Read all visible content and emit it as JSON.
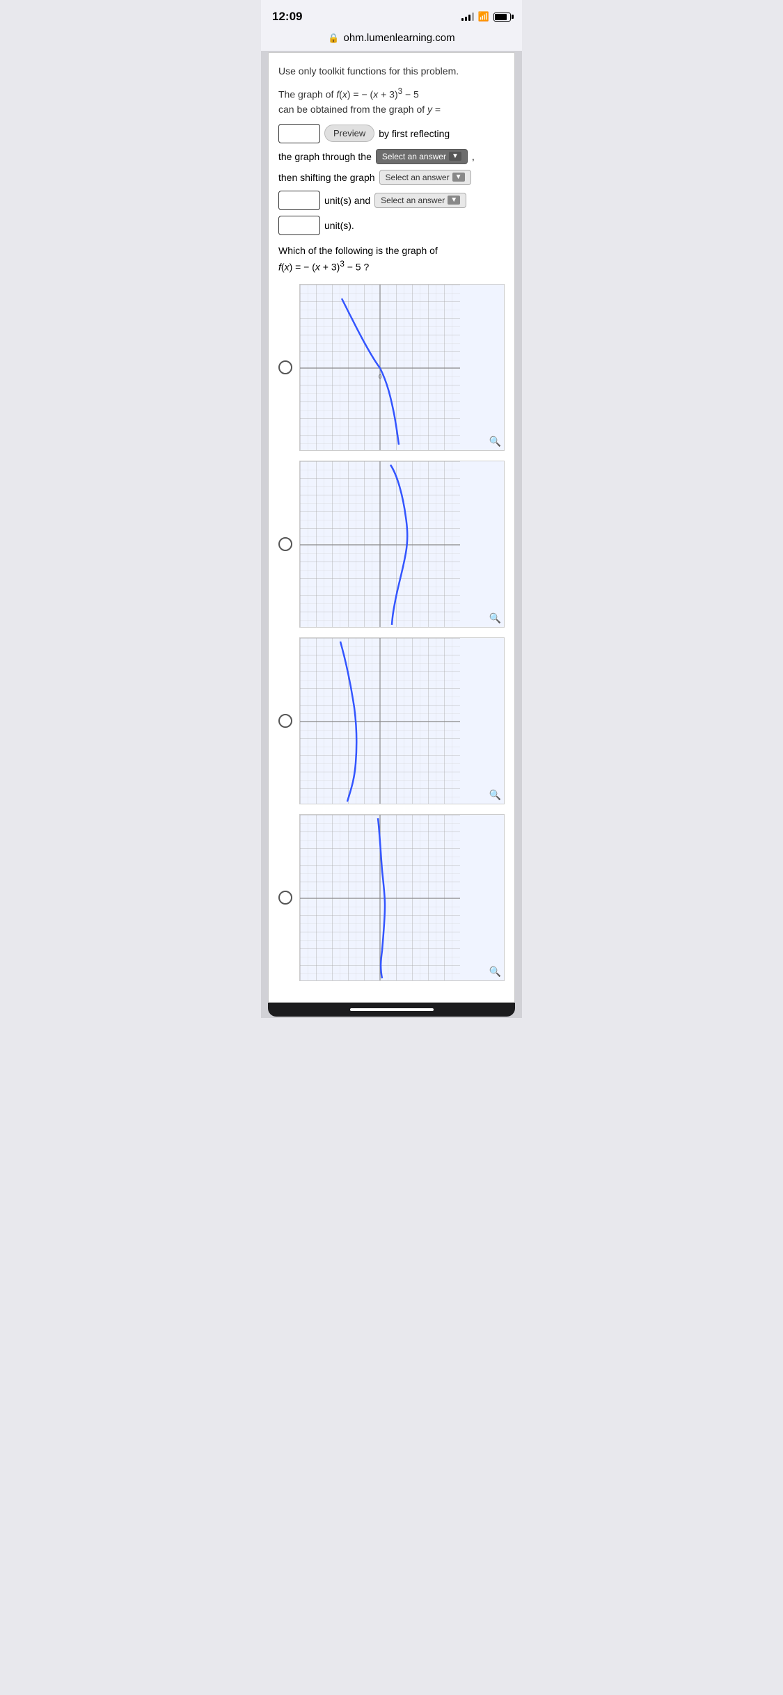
{
  "statusBar": {
    "time": "12:09",
    "domain": "ohm.lumenlearning.com"
  },
  "problem": {
    "instruction": "Use only toolkit functions for this problem.",
    "equation_line1": "The graph of f(x) = − (x + 3)³ − 5",
    "equation_line2": "can be obtained from the graph of y =",
    "preview_label": "Preview",
    "by_first": "by first reflecting",
    "the_graph_through": "the graph through the",
    "select1": "Select an answer",
    "then_shifting": "then shifting the graph",
    "select2": "Select an answer",
    "unit_and": "unit(s) and",
    "select3": "Select an answer",
    "unit_s": "unit(s).",
    "question_label": "Which of the following is the graph of",
    "question_eq": "f(x) = − (x + 3)³ − 5 ?"
  },
  "graphs": [
    {
      "id": 1,
      "curve": "graph1"
    },
    {
      "id": 2,
      "curve": "graph2"
    },
    {
      "id": 3,
      "curve": "graph3"
    },
    {
      "id": 4,
      "curve": "graph4"
    }
  ]
}
